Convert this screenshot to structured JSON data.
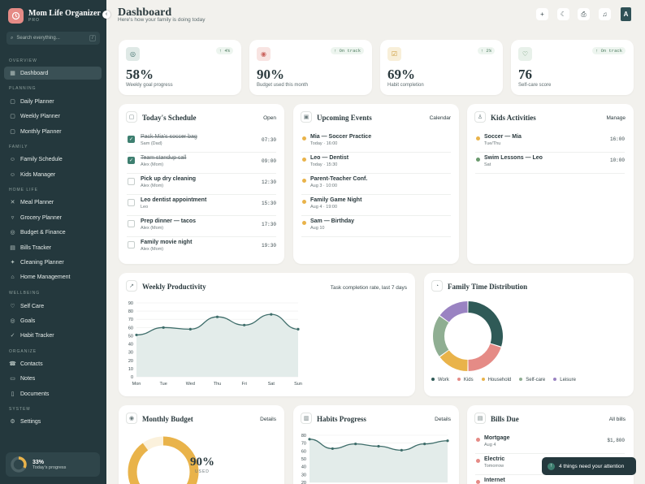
{
  "app": {
    "name": "Mom Life Organizer",
    "plan": "PRO"
  },
  "search": {
    "placeholder": "Search everything...",
    "shortcut": "/"
  },
  "sections": {
    "overview": "OVERVIEW",
    "planning": "PLANNING",
    "family": "FAMILY",
    "home_life": "HOME LIFE",
    "wellbeing": "WELLBEING",
    "organize": "ORGANIZE",
    "system": "SYSTEM"
  },
  "nav": {
    "dashboard": "Dashboard",
    "daily": "Daily Planner",
    "weekly": "Weekly Planner",
    "monthly": "Monthly Planner",
    "family_schedule": "Family Schedule",
    "kids_manager": "Kids Manager",
    "meal": "Meal Planner",
    "grocery": "Grocery Planner",
    "budget": "Budget & Finance",
    "bills": "Bills Tracker",
    "cleaning": "Cleaning Planner",
    "home_mgmt": "Home Management",
    "self_care": "Self Care",
    "goals": "Goals",
    "habit": "Habit Tracker",
    "contacts": "Contacts",
    "notes": "Notes",
    "documents": "Documents",
    "settings": "Settings"
  },
  "sidebar_progress": {
    "value": "33%",
    "label": "Today's progress",
    "fraction": 0.33
  },
  "header": {
    "title": "Dashboard",
    "subtitle": "Here's how your family is doing today",
    "avatar": "A"
  },
  "stats": [
    {
      "value": "58%",
      "label": "Weekly goal progress",
      "badge": "↑ 4%",
      "color": "#dfe9e6"
    },
    {
      "value": "90%",
      "label": "Budget used this month",
      "badge": "↑ On track",
      "color": "#f8e4e2"
    },
    {
      "value": "69%",
      "label": "Habit completion",
      "badge": "↑ 2%",
      "color": "#f8efd9"
    },
    {
      "value": "76",
      "label": "Self-care score",
      "badge": "↑ On track",
      "color": "#e8f1ea"
    }
  ],
  "schedule": {
    "title": "Today's Schedule",
    "link": "Open",
    "tasks": [
      {
        "name": "Pack Mia's soccer bag",
        "who": "Sam (Dad)",
        "time": "07:30",
        "done": true
      },
      {
        "name": "Team standup call",
        "who": "Alex (Mom)",
        "time": "09:00",
        "done": true
      },
      {
        "name": "Pick up dry cleaning",
        "who": "Alex (Mom)",
        "time": "12:30",
        "done": false
      },
      {
        "name": "Leo dentist appointment",
        "who": "Leo",
        "time": "15:30",
        "done": false
      },
      {
        "name": "Prep dinner — tacos",
        "who": "Alex (Mom)",
        "time": "17:30",
        "done": false
      },
      {
        "name": "Family movie night",
        "who": "Alex (Mom)",
        "time": "19:30",
        "done": false
      }
    ]
  },
  "events": {
    "title": "Upcoming Events",
    "link": "Calendar",
    "items": [
      {
        "name": "Mia — Soccer Practice",
        "when": "Today · 16:00",
        "color": "#e9b34a"
      },
      {
        "name": "Leo — Dentist",
        "when": "Today · 15:30",
        "color": "#e9b34a"
      },
      {
        "name": "Parent-Teacher Conf.",
        "when": "Aug 3 · 10:00",
        "color": "#e9b34a"
      },
      {
        "name": "Family Game Night",
        "when": "Aug 4 · 19:00",
        "color": "#e9b34a"
      },
      {
        "name": "Sam — Birthday",
        "when": "Aug 10",
        "color": "#e9b34a"
      }
    ]
  },
  "kids": {
    "title": "Kids Activities",
    "link": "Manage",
    "items": [
      {
        "name": "Soccer — Mia",
        "when": "Tue/Thu",
        "time": "16:00",
        "color": "#e9b34a"
      },
      {
        "name": "Swim Lessons — Leo",
        "when": "Sat",
        "time": "10:00",
        "color": "#6a9a6e"
      }
    ]
  },
  "productivity": {
    "title": "Weekly Productivity",
    "note": "Task completion rate, last 7 days"
  },
  "distribution": {
    "title": "Family Time Distribution"
  },
  "budget": {
    "title": "Monthly Budget",
    "link": "Details",
    "value": "90%",
    "label": "USED",
    "fraction": 0.9
  },
  "habits": {
    "title": "Habits Progress",
    "link": "Details"
  },
  "bills": {
    "title": "Bills Due",
    "link": "All bills",
    "items": [
      {
        "name": "Mortgage",
        "when": "Aug 4",
        "amount": "$1,800"
      },
      {
        "name": "Electric",
        "when": "Tomorrow",
        "amount": ""
      },
      {
        "name": "Internet",
        "when": "",
        "amount": ""
      }
    ]
  },
  "toast": {
    "icon": "!",
    "text": "4 things need your attention"
  },
  "chart_data": [
    {
      "type": "area",
      "title": "Weekly Productivity",
      "categories": [
        "Mon",
        "Tue",
        "Wed",
        "Thu",
        "Fri",
        "Sat",
        "Sun"
      ],
      "series": [
        {
          "values": [
            51,
            60,
            58,
            73,
            63,
            76,
            58
          ]
        }
      ],
      "ylim": [
        0,
        90
      ],
      "yticks": [
        0,
        10,
        20,
        30,
        40,
        50,
        60,
        70,
        80,
        90
      ],
      "grid": true,
      "color": "#3e6d6a"
    },
    {
      "type": "pie",
      "title": "Family Time Distribution",
      "donut": true,
      "labels": [
        "Work",
        "Kids",
        "Household",
        "Self-care",
        "Leisure"
      ],
      "values": [
        30,
        20,
        15,
        20,
        15
      ],
      "colors": [
        "#2f5a57",
        "#e58b86",
        "#e9b34a",
        "#8fae92",
        "#9a83c2"
      ],
      "legend": "bottom"
    },
    {
      "type": "area",
      "title": "Habits Progress",
      "categories": [
        "",
        "",
        "",
        "",
        "",
        "",
        ""
      ],
      "series": [
        {
          "values": [
            75,
            63,
            69,
            66,
            61,
            69,
            73
          ]
        }
      ],
      "ylim": [
        20,
        80
      ],
      "yticks": [
        20,
        30,
        40,
        50,
        60,
        70,
        80
      ],
      "grid": true,
      "color": "#3e6d6a"
    }
  ]
}
